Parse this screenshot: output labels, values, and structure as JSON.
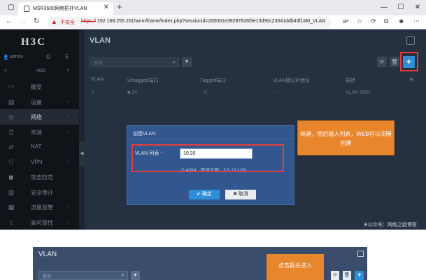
{
  "browser": {
    "tab_title": "MSR3600网络拓扑VLAN",
    "tab_close": "✕",
    "new_tab": "+",
    "window_controls": [
      "—",
      "☐",
      "✕"
    ],
    "nav": {
      "back": "←",
      "forward": "→",
      "reload": "↻"
    },
    "security_warning_icon": "▲",
    "security_label": "不安全",
    "url_scheme": "https://",
    "url_rest": "192.168.255.201/wnm/frame/index.php?sessionid=200001e39297826f3e13d90c23041ddb43f1#M_VLAN",
    "toolbar": [
      "aᵃ",
      "☆",
      "⟳",
      "⧉",
      "☻",
      "⋯"
    ]
  },
  "app": {
    "logo": "H3C",
    "user_name": "admin",
    "user_icons": [
      "⎙",
      "⎘"
    ],
    "device_name": "H3C",
    "device_nav": {
      "prev": "<",
      "next": ">"
    },
    "collapse_arrow": "◀",
    "menu": [
      {
        "label": "概览",
        "icon": "〰",
        "icon_name": "overview-icon",
        "arrow": ""
      },
      {
        "label": "设备",
        "icon": "▤",
        "icon_name": "device-icon",
        "arrow": "›"
      },
      {
        "label": "网络",
        "icon": "◎",
        "icon_name": "network-icon",
        "arrow": "›",
        "active": true
      },
      {
        "label": "资源",
        "icon": "☰",
        "icon_name": "resource-icon",
        "arrow": "›"
      },
      {
        "label": "NAT",
        "icon": "⇄",
        "icon_name": "nat-icon",
        "arrow": ""
      },
      {
        "label": "VPN",
        "icon": "⛉",
        "icon_name": "vpn-icon",
        "arrow": "›"
      },
      {
        "label": "攻击防范",
        "icon": "◼",
        "icon_name": "attack-defense-icon",
        "arrow": ""
      },
      {
        "label": "安全审计",
        "icon": "▥",
        "icon_name": "security-audit-icon",
        "arrow": ""
      },
      {
        "label": "流量监管",
        "icon": "▦",
        "icon_name": "traffic-monitor-icon",
        "arrow": "›"
      },
      {
        "label": "高可靠性",
        "icon": "⟟",
        "icon_name": "high-availability-icon",
        "arrow": "›"
      }
    ],
    "page_title": "VLAN",
    "search_placeholder": "查询",
    "search_icon": "⌕",
    "filter_icon": "▼",
    "refresh_icon": "⟳",
    "delete_icon": "🗑",
    "add_icon": "+",
    "table": {
      "columns": [
        "VLAN",
        "Untagged端口",
        "Tagged端口",
        "VLAN接口IP地址",
        "描述",
        "☰"
      ],
      "rows": [
        [
          "1",
          "■ 24",
          "0",
          "--",
          "VLAN 0001"
        ]
      ]
    }
  },
  "dialog": {
    "title": "创建VLAN",
    "field_label": "VLAN 列表",
    "required_mark": "*",
    "field_value": "10,20",
    "hint": "(2-4094，取值示例：3,5,10-100)",
    "ok_label": "✔ 确定",
    "cancel_label": "✖ 取消"
  },
  "callouts": {
    "create_note": "新建，然后输入列表，WEB可以间隔创建",
    "click_arrow_note": "点击箭头进入"
  },
  "watermark": "⊕公众号：网络之路博客",
  "second_shot": {
    "title": "VLAN",
    "search_placeholder": "查询",
    "search_icon": "⌕",
    "filter_icon": "▼",
    "refresh_icon": "⟳",
    "delete_icon": "🗑",
    "add_icon": "+"
  },
  "colors": {
    "sidebar_bg": "#101317",
    "main_bg": "#253040",
    "dialog_bg": "#32568e",
    "accent_blue": "#2e8fd7",
    "callout_orange": "#e8862e",
    "highlight_red": "#e43d3d"
  }
}
